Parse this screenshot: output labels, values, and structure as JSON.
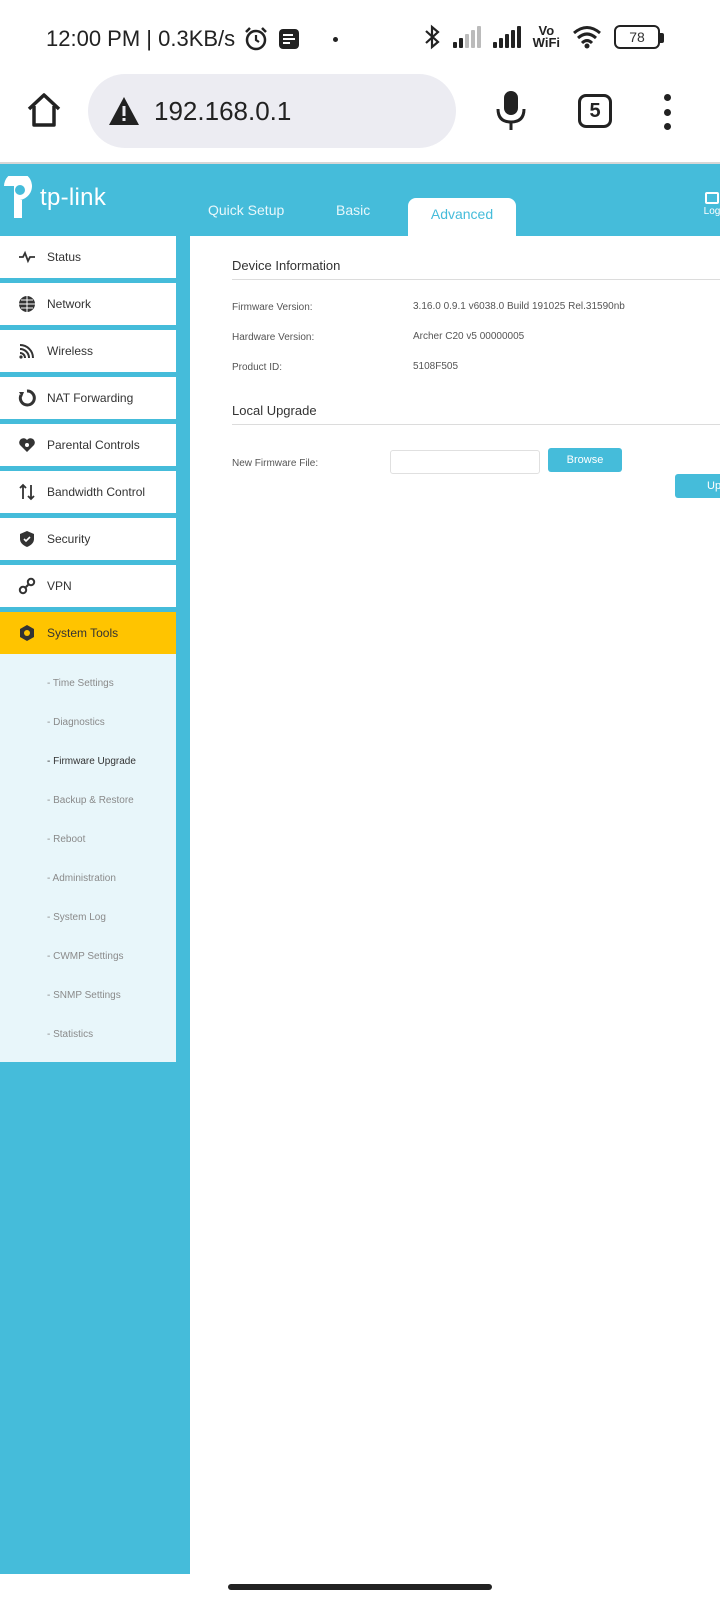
{
  "status_bar": {
    "time_speed": "12:00 PM | 0.3KB/s",
    "vowifi": "Vo\nWiFi",
    "battery": "78"
  },
  "browser": {
    "url": "192.168.0.1",
    "tab_count": "5"
  },
  "router": {
    "logo_text": "tp-link",
    "tabs": [
      "Quick Setup",
      "Basic",
      "Advanced"
    ],
    "logout_label": "Log",
    "sidebar": [
      {
        "label": "Status",
        "icon": "pulse-icon"
      },
      {
        "label": "Network",
        "icon": "globe-icon"
      },
      {
        "label": "Wireless",
        "icon": "wifi-icon"
      },
      {
        "label": "NAT Forwarding",
        "icon": "refresh-icon"
      },
      {
        "label": "Parental Controls",
        "icon": "heart-icon"
      },
      {
        "label": "Bandwidth Control",
        "icon": "updown-arrows-icon"
      },
      {
        "label": "Security",
        "icon": "shield-icon"
      },
      {
        "label": "VPN",
        "icon": "link-icon"
      },
      {
        "label": "System Tools",
        "icon": "gear-icon"
      }
    ],
    "submenu": [
      "- Time Settings",
      "- Diagnostics",
      "- Firmware Upgrade",
      "- Backup & Restore",
      "- Reboot",
      "- Administration",
      "- System Log",
      "- CWMP Settings",
      "- SNMP Settings",
      "- Statistics"
    ],
    "device_info": {
      "title": "Device Information",
      "firmware_label": "Firmware Version:",
      "firmware_value": "3.16.0 0.9.1 v6038.0 Build 191025 Rel.31590nb",
      "hardware_label": "Hardware Version:",
      "hardware_value": "Archer C20 v5 00000005",
      "product_label": "Product ID:",
      "product_value": "5108F505"
    },
    "local_upgrade": {
      "title": "Local Upgrade",
      "file_label": "New Firmware File:",
      "browse": "Browse",
      "upgrade": "Up"
    }
  },
  "colors": {
    "brand": "#45bcda",
    "active": "#ffc400"
  }
}
